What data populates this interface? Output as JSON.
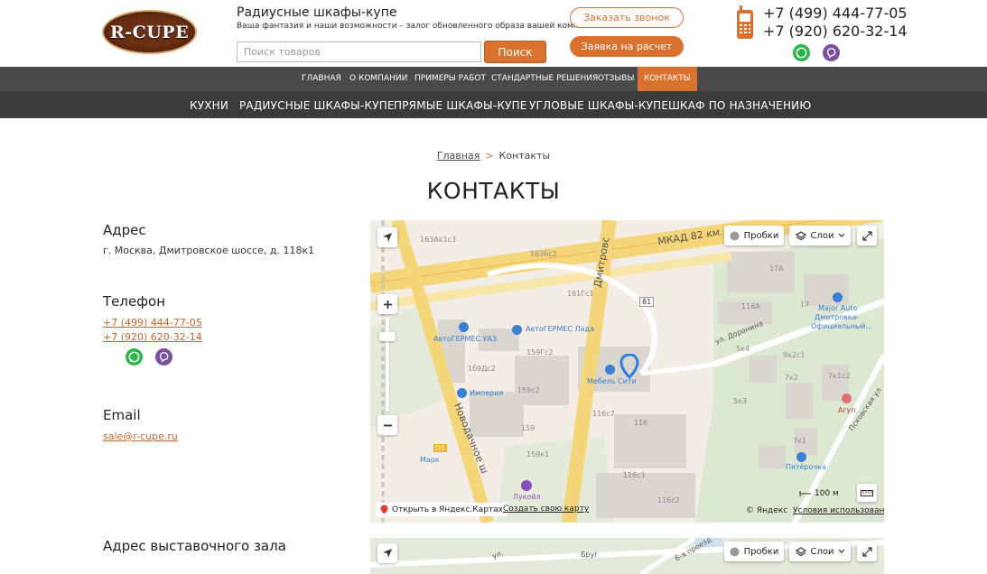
{
  "header": {
    "logo_text": "R-CUPE",
    "site_title": "Радиусные шкафы-купе",
    "tagline": "Ваша фантазия и наши возможности – залог обновленного образа вашей комнаты",
    "search_placeholder": "Поиск товаров",
    "search_button": "Поиск",
    "callback_button": "Заказать звонок",
    "order_button": "Заявка на расчет",
    "phone1": "+7 (499) 444-77-05",
    "phone2": "+7 (920) 620-32-14"
  },
  "nav_top": [
    {
      "label": "ГЛАВНАЯ",
      "active": false
    },
    {
      "label": "О КОМПАНИИ",
      "active": false
    },
    {
      "label": "ПРИМЕРЫ РАБОТ",
      "active": false
    },
    {
      "label": "СТАНДАРТНЫЕ РЕШЕНИЯ",
      "active": false
    },
    {
      "label": "ОТЗЫВЫ",
      "active": false
    },
    {
      "label": "КОНТАКТЫ",
      "active": true
    }
  ],
  "nav_main": [
    {
      "label": "КУХНИ"
    },
    {
      "label": "РАДИУСНЫЕ ШКАФЫ-КУПЕ"
    },
    {
      "label": "ПРЯМЫЕ ШКАФЫ-КУПЕ"
    },
    {
      "label": "УГЛОВЫЕ ШКАФЫ-КУПЕ"
    },
    {
      "label": "ШКАФ ПО НАЗНАЧЕНИЮ"
    }
  ],
  "breadcrumb": {
    "home": "Главная",
    "separator": ">",
    "current": "Контакты"
  },
  "page_title": "КОНТАКТЫ",
  "address": {
    "heading": "Адрес",
    "text": "г. Москва, Дмитровское шоссе, д. 118к1"
  },
  "phone": {
    "heading": "Телефон",
    "phone1": "+7 (499) 444-77-05",
    "phone2": "+7 (920) 620-32-14"
  },
  "email": {
    "heading": "Email",
    "address": "sale@r-cupe.ru"
  },
  "showroom": {
    "heading": "Адрес выставочного зала"
  },
  "map": {
    "traffic": "Пробки",
    "layers": "Слои",
    "open_yandex": "Открыть в Яндекс.Картах",
    "create_map": "Создать свою карту",
    "scale": "100 м",
    "copyright": "© Яндекс",
    "terms": "Условия использования",
    "labels": {
      "mkad": "МКАД 82 км",
      "dmitrovskoe": "Дмитровс",
      "novodachnoe": "Новодачное ш",
      "doronina": "ул. Доронина",
      "pskovskaya": "Псковская ул",
      "autogermes_uaz": "АвтоГЕРМЕС УАЗ",
      "autogermes_lada": "АвтоГЕРМЕС Лада",
      "major_auto": "Major Auto",
      "major_auto2": "Дмитровка-",
      "major_auto3": "Официальный...",
      "mebel_city": "Мебель Сити",
      "imperia": "Империя",
      "agun": "Агуп",
      "mark": "Марк",
      "pyaterochka": "Пятёрочка",
      "lukoil": "Лукойл",
      "b163": "163Ак1с3",
      "b163c2": "163бс2",
      "b161": "161Гс1",
      "b159c2": "159Гс2",
      "b159c2b": "159с2",
      "b159": "159",
      "b159k1": "159к1",
      "b116c7": "116с7",
      "b116": "116",
      "b116c1": "116с1",
      "b116c2": "116с2",
      "b116a": "116А",
      "b17": "17",
      "b17a": "17А",
      "b5k4": "5к4",
      "b9k2c1": "9к2с1",
      "b7k2": "7к2",
      "b7k1c2": "7к1с2",
      "b5k3": "5к3",
      "b7k1": "7к1",
      "b81": "81",
      "d1": "D1",
      "b186c2": "1б9Дс2"
    },
    "map2_labels": {
      "ul": "ул.",
      "psk": "6-я проезд",
      "vrg": "Бруг"
    }
  }
}
